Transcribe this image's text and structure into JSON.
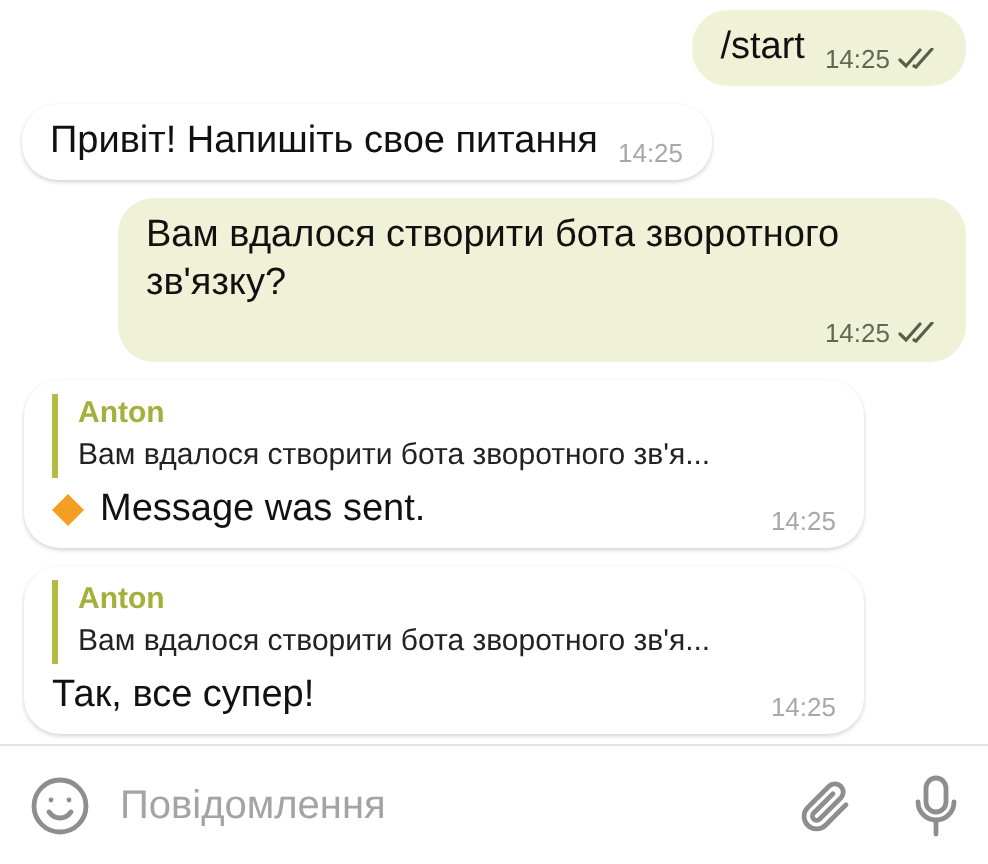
{
  "messages": [
    {
      "kind": "text",
      "outgoing": true,
      "read": true,
      "text": "/start",
      "time": "14:25"
    },
    {
      "kind": "text",
      "outgoing": false,
      "text": "Привіт! Напишіть свое питання",
      "time": "14:25"
    },
    {
      "kind": "text",
      "outgoing": true,
      "read": true,
      "text": "Вам вдалося створити бота зворотного зв'язку?",
      "time": "14:25"
    },
    {
      "kind": "reply_status",
      "outgoing": false,
      "reply_to": {
        "author": "Anton",
        "text": "Вам вдалося створити бота зворотного зв'я..."
      },
      "text": "Message was sent.",
      "time": "14:25"
    },
    {
      "kind": "reply",
      "outgoing": false,
      "reply_to": {
        "author": "Anton",
        "text": "Вам вдалося створити бота зворотного зв'я..."
      },
      "text": "Так, все супер!",
      "time": "14:25"
    }
  ],
  "composer": {
    "placeholder": "Повідомлення"
  }
}
